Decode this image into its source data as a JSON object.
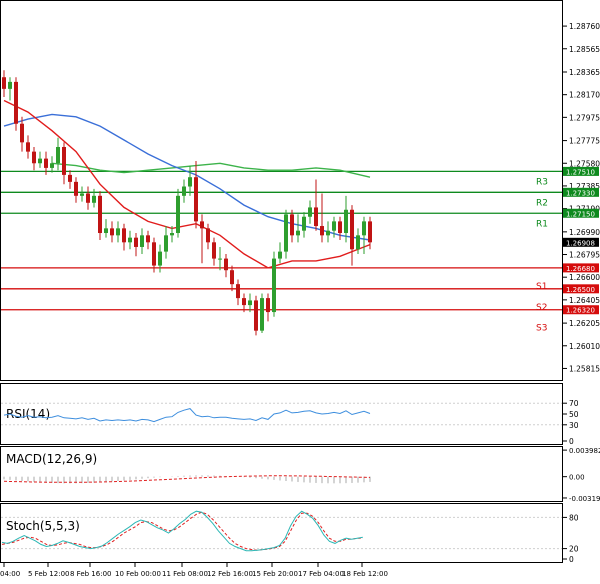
{
  "colors": {
    "frame": "#000000",
    "bull_candle": "#2e9e2e",
    "bear_candle": "#c01414",
    "ma_fast": "#e11c1c",
    "ma_mid": "#3a6fd8",
    "ma_slow": "#3cb34a",
    "resistance": "#0e8a1e",
    "support": "#d50c0c",
    "price_box": "#000000",
    "rsi": "#3d8ede",
    "macd_signal": "#e02020",
    "stoch_main": "#2cb7b5",
    "stoch_signal": "#e02020"
  },
  "chart_data": {
    "type": "candlestick",
    "price_axis": {
      "min": 1.2575,
      "max": 1.2895,
      "ticks": [
        "1.28760",
        "1.28565",
        "1.28365",
        "1.28170",
        "1.27975",
        "1.27775",
        "1.27580",
        "1.27385",
        "1.27190",
        "1.26990",
        "1.26795",
        "1.26600",
        "1.26405",
        "1.26205",
        "1.26010",
        "1.25815"
      ]
    },
    "time_labels": [
      "04:00",
      "5 Feb 12:00",
      "8 Feb 16:00",
      "10 Feb 00:00",
      "11 Feb 08:00",
      "12 Feb 16:00",
      "15 Feb 20:00",
      "17 Feb 04:00",
      "18 Feb 12:00"
    ],
    "level_lines": [
      {
        "name": "R3",
        "value": 1.2751,
        "label": "1.27510",
        "kind": "resistance"
      },
      {
        "name": "R2",
        "value": 1.2733,
        "label": "1.27330",
        "kind": "resistance"
      },
      {
        "name": "R1",
        "value": 1.2715,
        "label": "1.27150",
        "kind": "resistance"
      },
      {
        "name": "S1",
        "value": 1.2668,
        "label": "1.26680",
        "kind": "support"
      },
      {
        "name": "S2",
        "value": 1.265,
        "label": "1.26500",
        "kind": "support"
      },
      {
        "name": "S3",
        "value": 1.2632,
        "label": "1.26320",
        "kind": "support"
      }
    ],
    "current_price": {
      "value": 1.269,
      "label": "1.26908"
    },
    "candles": [
      [
        1.2832,
        1.2822,
        1.2838,
        1.2815
      ],
      [
        1.2822,
        1.2828,
        1.2832,
        1.2812
      ],
      [
        1.2828,
        1.2792,
        1.2832,
        1.2786
      ],
      [
        1.2792,
        1.2776,
        1.2798,
        1.2768
      ],
      [
        1.2776,
        1.2768,
        1.2782,
        1.2762
      ],
      [
        1.2768,
        1.2758,
        1.2772,
        1.2752
      ],
      [
        1.2758,
        1.2762,
        1.2768,
        1.2754
      ],
      [
        1.2762,
        1.2754,
        1.2768,
        1.2748
      ],
      [
        1.2754,
        1.2758,
        1.2764,
        1.275
      ],
      [
        1.2758,
        1.2772,
        1.278,
        1.2752
      ],
      [
        1.2772,
        1.2748,
        1.2776,
        1.274
      ],
      [
        1.2748,
        1.2742,
        1.2752,
        1.2736
      ],
      [
        1.2742,
        1.273,
        1.2746,
        1.2724
      ],
      [
        1.273,
        1.2732,
        1.2738,
        1.2725
      ],
      [
        1.2732,
        1.2724,
        1.2738,
        1.2718
      ],
      [
        1.2724,
        1.273,
        1.2736,
        1.272
      ],
      [
        1.273,
        1.2698,
        1.2734,
        1.2692
      ],
      [
        1.2698,
        1.2702,
        1.271,
        1.2694
      ],
      [
        1.2702,
        1.2696,
        1.2708,
        1.269
      ],
      [
        1.2696,
        1.2702,
        1.2708,
        1.269
      ],
      [
        1.2702,
        1.269,
        1.2706,
        1.2683
      ],
      [
        1.269,
        1.2694,
        1.27,
        1.2684
      ],
      [
        1.2694,
        1.2686,
        1.2698,
        1.2678
      ],
      [
        1.2686,
        1.2696,
        1.2702,
        1.268
      ],
      [
        1.2696,
        1.269,
        1.27,
        1.2684
      ],
      [
        1.269,
        1.267,
        1.2694,
        1.2664
      ],
      [
        1.267,
        1.2682,
        1.2688,
        1.2664
      ],
      [
        1.2682,
        1.2696,
        1.2704,
        1.2676
      ],
      [
        1.2696,
        1.2698,
        1.2704,
        1.269
      ],
      [
        1.2698,
        1.273,
        1.2736,
        1.2694
      ],
      [
        1.273,
        1.2738,
        1.2744,
        1.2724
      ],
      [
        1.2738,
        1.2746,
        1.2756,
        1.273
      ],
      [
        1.2746,
        1.2708,
        1.276,
        1.2702
      ],
      [
        1.2708,
        1.2702,
        1.2714,
        1.2672
      ],
      [
        1.2702,
        1.269,
        1.2706,
        1.2684
      ],
      [
        1.269,
        1.2676,
        1.2694,
        1.267
      ],
      [
        1.2676,
        1.2676,
        1.2686,
        1.2666
      ],
      [
        1.2676,
        1.2666,
        1.268,
        1.266
      ],
      [
        1.2666,
        1.2654,
        1.267,
        1.2648
      ],
      [
        1.2654,
        1.2642,
        1.2658,
        1.2636
      ],
      [
        1.2642,
        1.2636,
        1.2646,
        1.263
      ],
      [
        1.2636,
        1.264,
        1.2646,
        1.263
      ],
      [
        1.264,
        1.2614,
        1.2644,
        1.261
      ],
      [
        1.2614,
        1.2642,
        1.2646,
        1.2612
      ],
      [
        1.2642,
        1.263,
        1.2646,
        1.2622
      ],
      [
        1.263,
        1.2676,
        1.2682,
        1.2626
      ],
      [
        1.2676,
        1.2682,
        1.269,
        1.2672
      ],
      [
        1.2682,
        1.2714,
        1.2718,
        1.2676
      ],
      [
        1.2714,
        1.2696,
        1.2718,
        1.269
      ],
      [
        1.2696,
        1.27,
        1.2714,
        1.269
      ],
      [
        1.27,
        1.2712,
        1.2716,
        1.2694
      ],
      [
        1.2712,
        1.272,
        1.2726,
        1.2706
      ],
      [
        1.272,
        1.2704,
        1.2744,
        1.27
      ],
      [
        1.2704,
        1.2696,
        1.2732,
        1.269
      ],
      [
        1.2696,
        1.27,
        1.2708,
        1.269
      ],
      [
        1.27,
        1.2708,
        1.2712,
        1.2694
      ],
      [
        1.2708,
        1.2698,
        1.2712,
        1.2692
      ],
      [
        1.2698,
        1.2718,
        1.273,
        1.269
      ],
      [
        1.2718,
        1.2684,
        1.2722,
        1.267
      ],
      [
        1.2684,
        1.2696,
        1.2702,
        1.268
      ],
      [
        1.2696,
        1.2708,
        1.2712,
        1.268
      ],
      [
        1.2708,
        1.269,
        1.2712,
        1.2684
      ]
    ],
    "ma_fast": [
      [
        0,
        1.2812
      ],
      [
        4,
        1.2802
      ],
      [
        8,
        1.2786
      ],
      [
        12,
        1.2768
      ],
      [
        16,
        1.274
      ],
      [
        20,
        1.272
      ],
      [
        24,
        1.2708
      ],
      [
        28,
        1.2702
      ],
      [
        32,
        1.2706
      ],
      [
        36,
        1.2696
      ],
      [
        40,
        1.268
      ],
      [
        44,
        1.2668
      ],
      [
        48,
        1.2674
      ],
      [
        52,
        1.2674
      ],
      [
        56,
        1.2678
      ],
      [
        61,
        1.2688
      ]
    ],
    "ma_mid": [
      [
        0,
        1.279
      ],
      [
        4,
        1.2796
      ],
      [
        8,
        1.28
      ],
      [
        12,
        1.2798
      ],
      [
        16,
        1.279
      ],
      [
        20,
        1.2778
      ],
      [
        24,
        1.2766
      ],
      [
        28,
        1.2756
      ],
      [
        32,
        1.2748
      ],
      [
        36,
        1.2736
      ],
      [
        40,
        1.2722
      ],
      [
        44,
        1.2712
      ],
      [
        48,
        1.2706
      ],
      [
        52,
        1.2702
      ],
      [
        56,
        1.2696
      ],
      [
        61,
        1.2692
      ]
    ],
    "ma_slow": [
      [
        8,
        1.2758
      ],
      [
        12,
        1.2756
      ],
      [
        16,
        1.2752
      ],
      [
        20,
        1.275
      ],
      [
        24,
        1.2752
      ],
      [
        28,
        1.2754
      ],
      [
        32,
        1.2756
      ],
      [
        36,
        1.2758
      ],
      [
        40,
        1.2754
      ],
      [
        44,
        1.2752
      ],
      [
        48,
        1.2752
      ],
      [
        52,
        1.2754
      ],
      [
        56,
        1.2752
      ],
      [
        61,
        1.2746
      ]
    ],
    "rsi": {
      "label": "RSI(14)",
      "ticks": [
        "70",
        "50",
        "30",
        "0"
      ],
      "values": [
        48,
        50,
        46,
        44,
        47,
        44,
        45,
        43,
        44,
        47,
        43,
        42,
        41,
        43,
        40,
        42,
        37,
        39,
        38,
        39,
        38,
        39,
        37,
        40,
        39,
        36,
        40,
        44,
        45,
        53,
        57,
        60,
        48,
        45,
        46,
        43,
        44,
        44,
        42,
        41,
        40,
        41,
        38,
        43,
        40,
        50,
        52,
        57,
        52,
        53,
        55,
        56,
        52,
        50,
        51,
        53,
        51,
        56,
        49,
        52,
        55,
        51
      ]
    },
    "macd": {
      "label": "MACD(12,26,9)",
      "ticks": [
        "0.003982",
        "0.00",
        "-0.003195"
      ],
      "range": [
        -0.0032,
        0.004
      ]
    },
    "stoch": {
      "label": "Stoch(5,5,3)",
      "ticks": [
        "80",
        "20",
        "0"
      ],
      "main": [
        32,
        30,
        34,
        40,
        45,
        40,
        35,
        28,
        24,
        26,
        30,
        35,
        32,
        28,
        24,
        22,
        20,
        22,
        25,
        32,
        40,
        48,
        55,
        62,
        70,
        75,
        72,
        66,
        60,
        56,
        50,
        58,
        68,
        76,
        86,
        92,
        90,
        80,
        68,
        54,
        42,
        30,
        24,
        20,
        16,
        16,
        17,
        18,
        20,
        22,
        26,
        40,
        64,
        82,
        92,
        86,
        78,
        64,
        46,
        34,
        30,
        36,
        40,
        38,
        40,
        42
      ],
      "signal": [
        28,
        30,
        32,
        36,
        40,
        42,
        40,
        34,
        28,
        26,
        27,
        30,
        32,
        30,
        28,
        24,
        22,
        22,
        24,
        28,
        34,
        42,
        50,
        56,
        62,
        70,
        72,
        70,
        64,
        58,
        54,
        56,
        62,
        70,
        78,
        86,
        90,
        86,
        76,
        64,
        52,
        40,
        30,
        24,
        20,
        18,
        17,
        18,
        19,
        21,
        24,
        34,
        54,
        74,
        88,
        88,
        82,
        70,
        54,
        40,
        34,
        34,
        38,
        38,
        40,
        40
      ]
    }
  }
}
